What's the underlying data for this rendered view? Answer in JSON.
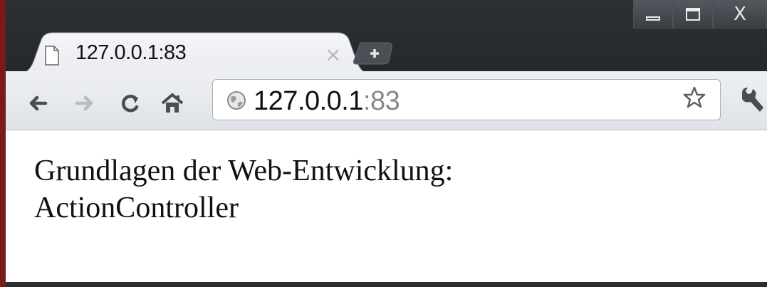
{
  "tab": {
    "title": "127.0.0.1:83",
    "close": "×"
  },
  "new_tab": {
    "label": "+"
  },
  "window_controls": {
    "close": "X"
  },
  "toolbar": {
    "back": "←",
    "forward": "→",
    "reload": "C",
    "home": "⌂"
  },
  "omnibox": {
    "host": "127.0.0.1",
    "port": ":83"
  },
  "page": {
    "line1": "Grundlagen der Web-Entwicklung:",
    "line2": "ActionController"
  },
  "icons": {
    "favicon": "page-icon",
    "globe": "globe-icon",
    "star": "star-icon",
    "wrench": "wrench-icon"
  },
  "colors": {
    "titlebar": "#2a2d31",
    "toolbar": "#e6e9ee",
    "page_bg": "#ffffff",
    "accent_red": "#7a1a1a"
  }
}
